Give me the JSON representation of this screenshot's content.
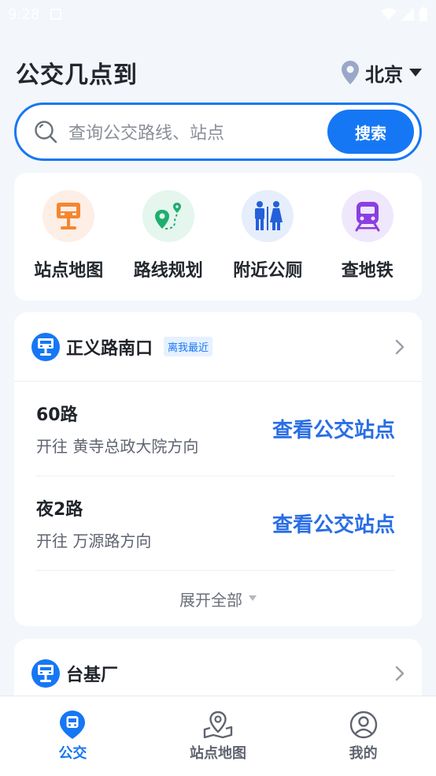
{
  "status_bar": {
    "time": "9:28"
  },
  "header": {
    "title": "公交几点到",
    "city": "北京"
  },
  "search": {
    "placeholder": "查询公交路线、站点",
    "button_label": "搜索"
  },
  "quick_actions": [
    {
      "label": "站点地图",
      "icon": "bus-stop-sign-icon"
    },
    {
      "label": "路线规划",
      "icon": "route-pin-icon"
    },
    {
      "label": "附近公厕",
      "icon": "restroom-icon"
    },
    {
      "label": "查地铁",
      "icon": "subway-train-icon"
    }
  ],
  "nearby_station": {
    "name": "正义路南口",
    "tag": "离我最近",
    "routes": [
      {
        "name": "60路",
        "direction": "开往 黄寺总政大院方向",
        "action": "查看公交站点"
      },
      {
        "name": "夜2路",
        "direction": "开往 万源路方向",
        "action": "查看公交站点"
      }
    ],
    "expand_label": "展开全部"
  },
  "second_station": {
    "name": "台基厂"
  },
  "bottom_nav": [
    {
      "label": "公交",
      "icon": "bus-icon",
      "active": true
    },
    {
      "label": "站点地图",
      "icon": "map-pin-icon",
      "active": false
    },
    {
      "label": "我的",
      "icon": "user-profile-icon",
      "active": false
    }
  ],
  "colors": {
    "accent": "#1677f5",
    "link": "#2a6ee5",
    "background": "#f3f6fb"
  }
}
